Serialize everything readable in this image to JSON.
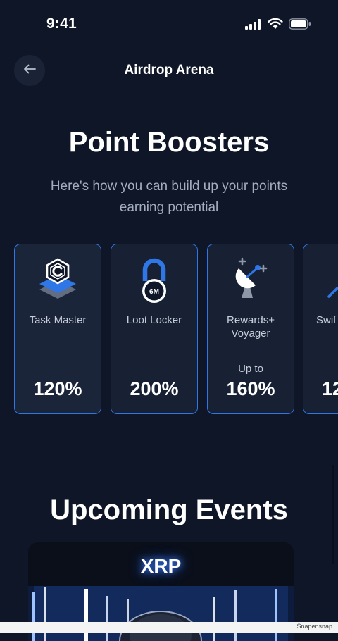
{
  "status_bar": {
    "time": "9:41"
  },
  "nav": {
    "title": "Airdrop Arena"
  },
  "boosters": {
    "title": "Point Boosters",
    "subtitle": "Here's how you can build up your points earning potential",
    "cards": [
      {
        "icon": "task-master-c-icon",
        "label": "Task Master",
        "prefix": "",
        "value": "120%"
      },
      {
        "icon": "padlock-6m-icon",
        "icon_text": "6M",
        "label": "Loot Locker",
        "prefix": "",
        "value": "200%"
      },
      {
        "icon": "satellite-dish-icon",
        "label": "Rewards+ Voyager",
        "prefix": "Up to",
        "value": "160%"
      },
      {
        "icon": "rocket-icon",
        "label": "Swif",
        "prefix": "",
        "value": "12"
      }
    ]
  },
  "events": {
    "title": "Upcoming Events",
    "first_event": {
      "name": "XRP"
    }
  },
  "watermark": "Snapensnap",
  "colors": {
    "background": "#0e1627",
    "card_border": "#2f76e6",
    "card_bg": "#172133",
    "accent_blue": "#2f76e6"
  }
}
